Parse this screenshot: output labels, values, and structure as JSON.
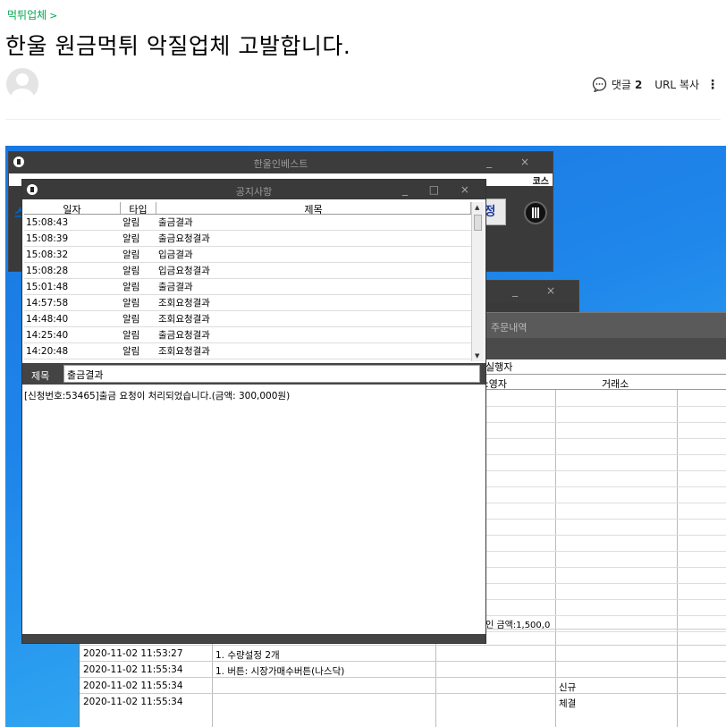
{
  "post": {
    "category": "먹튀업체",
    "category_chevron": ">",
    "title": "한울 원금먹튀 악질업체 고발합니다.",
    "comment_label": "댓글",
    "comment_count": "2",
    "url_copy": "URL 복사",
    "more": "⋮"
  },
  "screenshot": {
    "back_window_title": "한울인베스트",
    "back_window_right_text": "코스",
    "back_button_text": "정",
    "back_s_text": "스",
    "notice_window": {
      "title": "공지사항",
      "columns": [
        "일자",
        "타입",
        "제목"
      ],
      "rows": [
        {
          "time": "15:08:43",
          "type": "알림",
          "subject": "출금결과"
        },
        {
          "time": "15:08:39",
          "type": "알림",
          "subject": "출금요청결과"
        },
        {
          "time": "15:08:32",
          "type": "알림",
          "subject": "입금결과"
        },
        {
          "time": "15:08:28",
          "type": "알림",
          "subject": "입금요청결과"
        },
        {
          "time": "15:01:48",
          "type": "알림",
          "subject": "출금결과"
        },
        {
          "time": "14:57:58",
          "type": "알림",
          "subject": "조회요청결과"
        },
        {
          "time": "14:48:40",
          "type": "알림",
          "subject": "조회요청결과"
        },
        {
          "time": "14:25:40",
          "type": "알림",
          "subject": "출금요청결과"
        },
        {
          "time": "14:20:48",
          "type": "알림",
          "subject": "조회요청결과"
        }
      ],
      "subject_label": "제목",
      "subject_value": "출금결과",
      "body_text": "[신청번호:53465]출금 요청이 처리되었습니다.(금액: 300,000원)"
    },
    "order_window": {
      "title": "주문내역",
      "sub_label": "실행자",
      "col_operator": ":영자",
      "col_exchange": "거래소",
      "amount_note": "인 금액:1,500,0",
      "rows": [
        {
          "datetime": "2020-11-02 11:53:27",
          "desc": "1. 수량설정 2개",
          "status": ""
        },
        {
          "datetime": "2020-11-02 11:53:27",
          "desc": "1. 수량설정 2개",
          "status": ""
        },
        {
          "datetime": "2020-11-02 11:55:34",
          "desc": "1. 버튼: 시장가매수버튼(나스닥)",
          "status": ""
        },
        {
          "datetime": "2020-11-02 11:55:34",
          "desc": "",
          "status": "신규"
        },
        {
          "datetime": "2020-11-02 11:55:34",
          "desc": "",
          "status": "체결"
        }
      ]
    },
    "window_controls": "_ □ ×"
  }
}
